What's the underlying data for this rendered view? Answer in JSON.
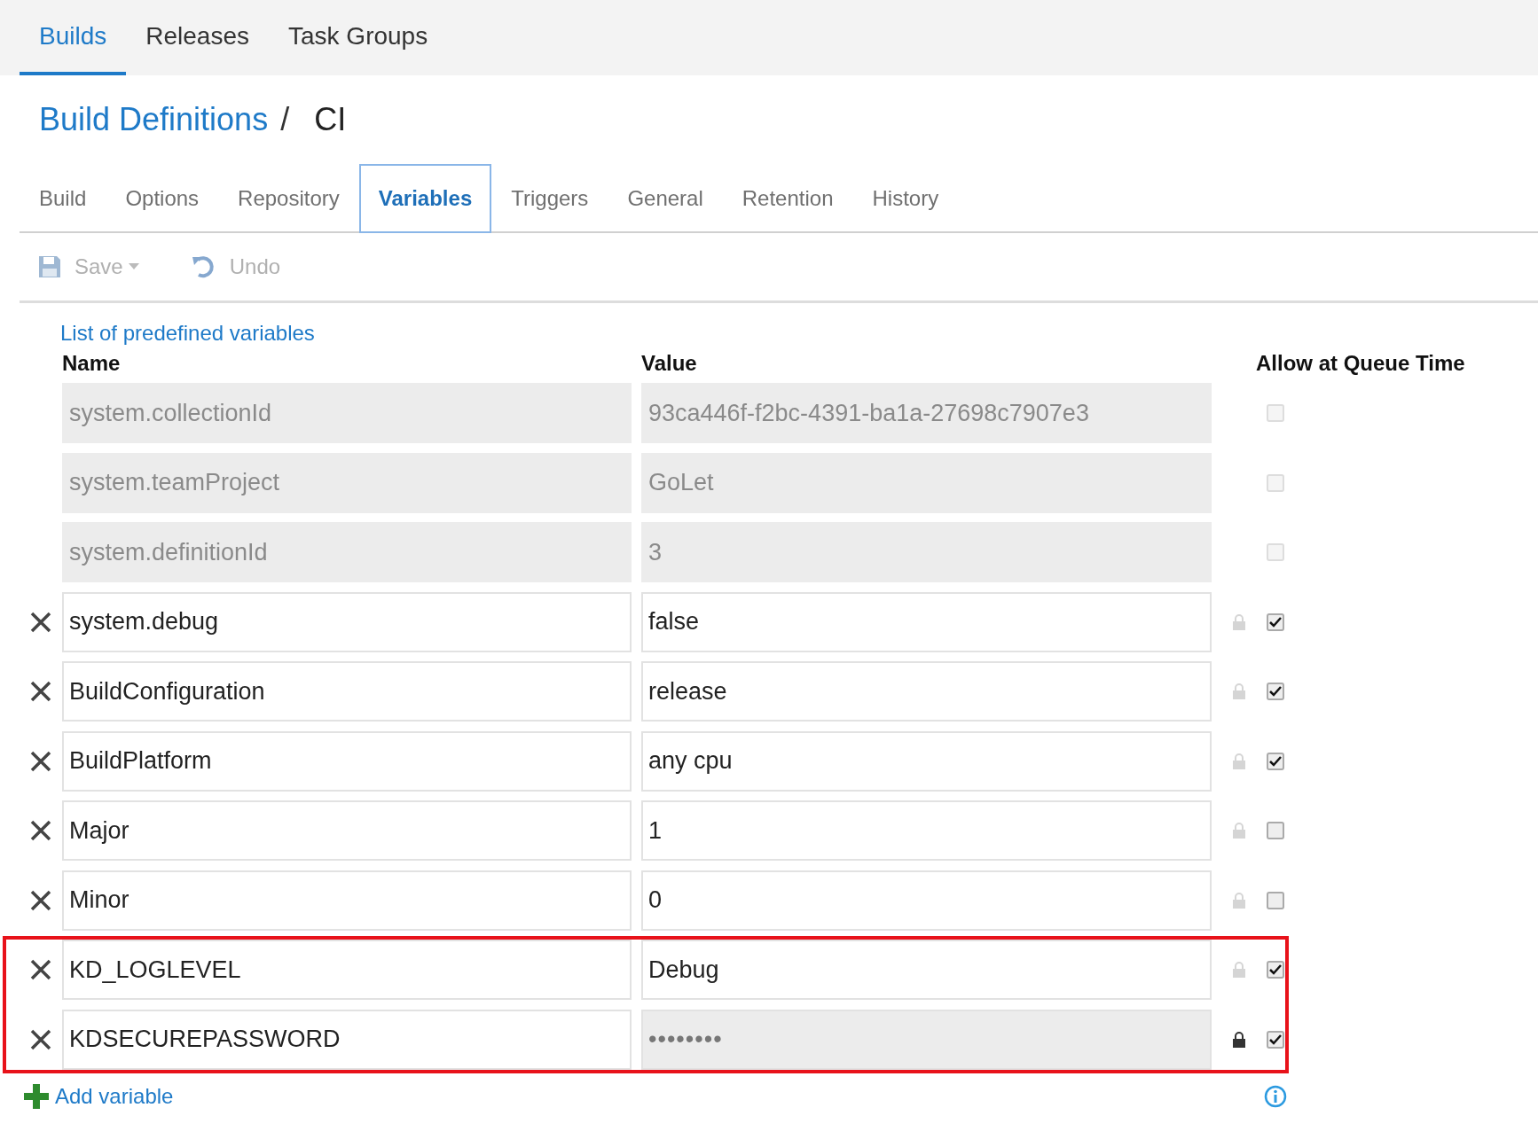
{
  "top_tabs": [
    {
      "label": "Builds",
      "selected": true
    },
    {
      "label": "Releases",
      "selected": false
    },
    {
      "label": "Task Groups",
      "selected": false
    }
  ],
  "breadcrumb": {
    "parent": "Build Definitions",
    "separator": "/",
    "current": "CI"
  },
  "definition_tabs": [
    {
      "label": "Build",
      "selected": false
    },
    {
      "label": "Options",
      "selected": false
    },
    {
      "label": "Repository",
      "selected": false
    },
    {
      "label": "Variables",
      "selected": true
    },
    {
      "label": "Triggers",
      "selected": false
    },
    {
      "label": "General",
      "selected": false
    },
    {
      "label": "Retention",
      "selected": false
    },
    {
      "label": "History",
      "selected": false
    }
  ],
  "toolbar": [
    {
      "kind": "save",
      "label": "Save",
      "disabled": true
    },
    {
      "kind": "undo",
      "label": "Undo",
      "disabled": true
    }
  ],
  "predefined_link": "List of predefined variables",
  "columns": [
    "Name",
    "Value",
    "Allow at Queue Time"
  ],
  "variables": [
    {
      "name": "system.collectionId",
      "value": "93ca446f-f2bc-4391-ba1a-27698c7907e3",
      "readonly": true,
      "secret": false,
      "allow_at_queue_time": false,
      "highlighted": false
    },
    {
      "name": "system.teamProject",
      "value": "GoLet",
      "readonly": true,
      "secret": false,
      "allow_at_queue_time": false,
      "highlighted": false
    },
    {
      "name": "system.definitionId",
      "value": "3",
      "readonly": true,
      "secret": false,
      "allow_at_queue_time": false,
      "highlighted": false
    },
    {
      "name": "system.debug",
      "value": "false",
      "readonly": false,
      "secret": false,
      "allow_at_queue_time": true,
      "highlighted": false
    },
    {
      "name": "BuildConfiguration",
      "value": "release",
      "readonly": false,
      "secret": false,
      "allow_at_queue_time": true,
      "highlighted": false
    },
    {
      "name": "BuildPlatform",
      "value": "any cpu",
      "readonly": false,
      "secret": false,
      "allow_at_queue_time": true,
      "highlighted": false
    },
    {
      "name": "Major",
      "value": "1",
      "readonly": false,
      "secret": false,
      "allow_at_queue_time": false,
      "highlighted": false
    },
    {
      "name": "Minor",
      "value": "0",
      "readonly": false,
      "secret": false,
      "allow_at_queue_time": false,
      "highlighted": false
    },
    {
      "name": "KD_LOGLEVEL",
      "value": "Debug",
      "readonly": false,
      "secret": false,
      "allow_at_queue_time": true,
      "highlighted": true
    },
    {
      "name": "KDSECUREPASSWORD",
      "value": "••••••••",
      "readonly": false,
      "secret": true,
      "allow_at_queue_time": true,
      "highlighted": true
    }
  ],
  "add_variable": "Add variable"
}
